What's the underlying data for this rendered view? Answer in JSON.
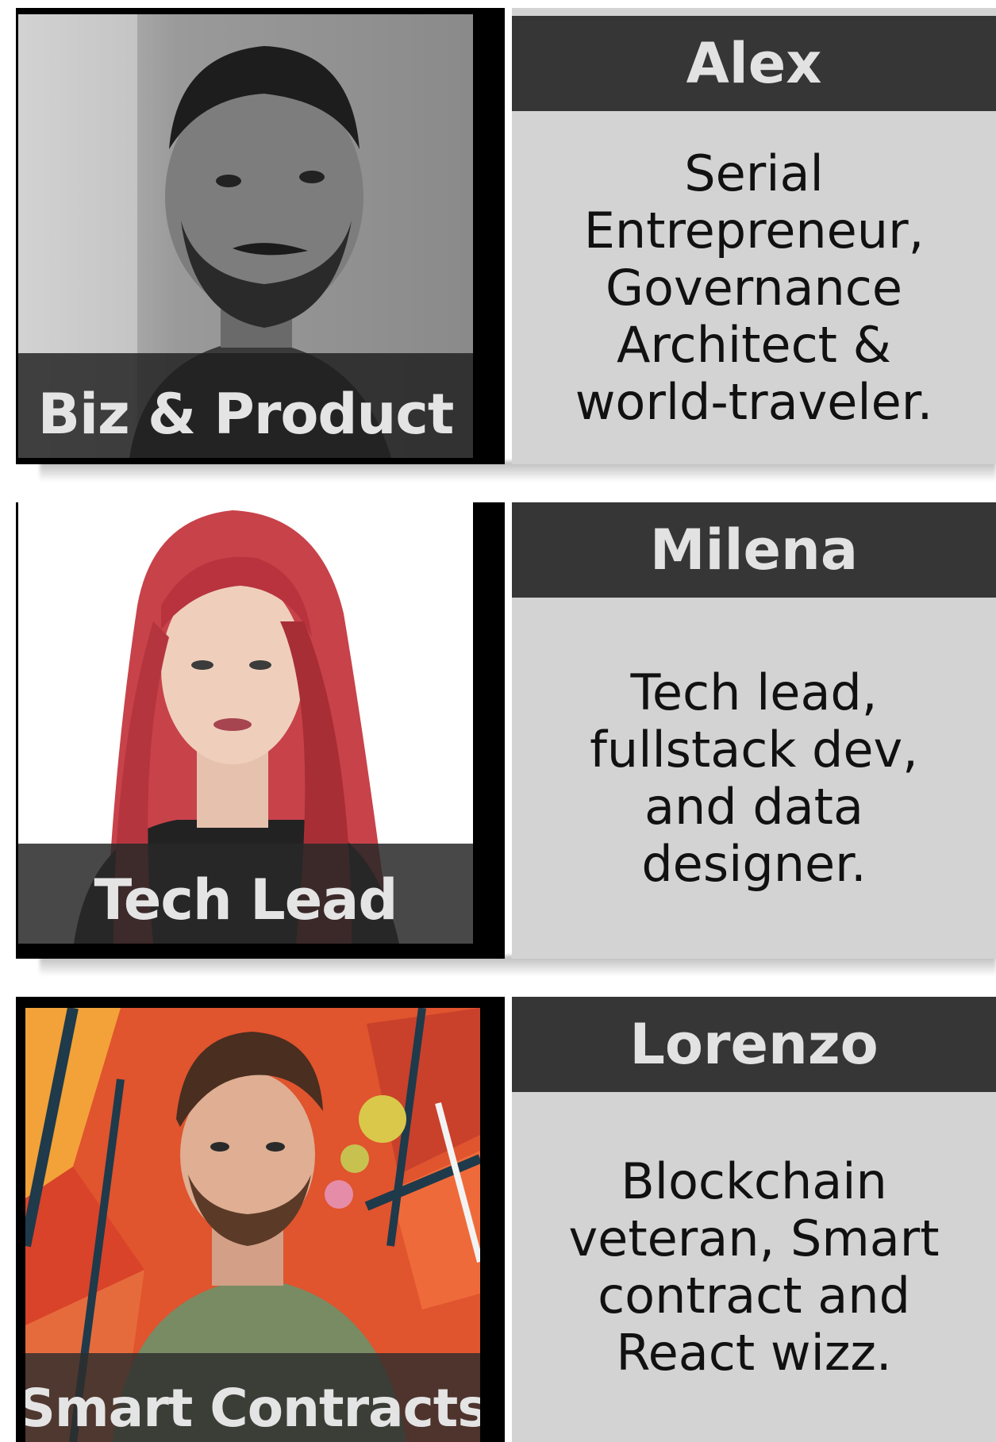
{
  "team": [
    {
      "name": "Alex",
      "role": "Biz & Product",
      "bio": "Serial Entrepreneur, Governance Architect & world-traveler.",
      "photo": "portrait-grayscale-bearded-man"
    },
    {
      "name": "Milena",
      "role": "Tech Lead",
      "bio": "Tech lead, fullstack dev, and data designer.",
      "photo": "portrait-red-haired-woman"
    },
    {
      "name": "Lorenzo",
      "role": "Smart Contracts",
      "bio": "Blockchain veteran, Smart contract and React wizz.",
      "photo": "portrait-man-graffiti-wall"
    }
  ],
  "colors": {
    "name_bar": "#363636",
    "info_panel": "#d3d3d3",
    "role_banner": "#1e1e1e",
    "frame": "#000000"
  }
}
